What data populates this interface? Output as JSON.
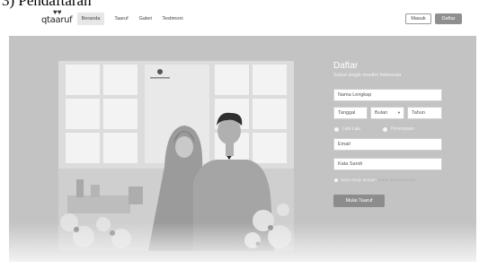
{
  "caption": "3) Pendaftaran",
  "brand": {
    "logo_text": "qtaaruf",
    "logo_mark": "♥♥"
  },
  "nav": {
    "items": [
      {
        "label": "Beranda",
        "active": true
      },
      {
        "label": "Taaruf",
        "active": false
      },
      {
        "label": "Galeri",
        "active": false
      },
      {
        "label": "Testimoni",
        "active": false
      }
    ]
  },
  "auth": {
    "login_label": "Masuk",
    "register_label": "Daftar"
  },
  "form": {
    "title": "Daftar",
    "subtitle": "Solusi single muslim Indonesia",
    "name_placeholder": "Nama Lengkap",
    "date": {
      "day_placeholder": "Tanggal",
      "month_placeholder": "Bulan",
      "year_placeholder": "Tahun"
    },
    "gender": {
      "male_label": "Laki-Laki",
      "female_label": "Perempuan"
    },
    "email_placeholder": "Email",
    "password_placeholder": "Kata Sandi",
    "agreement": {
      "text": "Saya setuju dengan",
      "link": "syarat dan ketentuan"
    },
    "submit_label": "Mulai Taaruf"
  },
  "colors": {
    "hero_bg": "#c3c3c3",
    "button_gray": "#8c8c8c",
    "text_white": "#ffffff"
  }
}
